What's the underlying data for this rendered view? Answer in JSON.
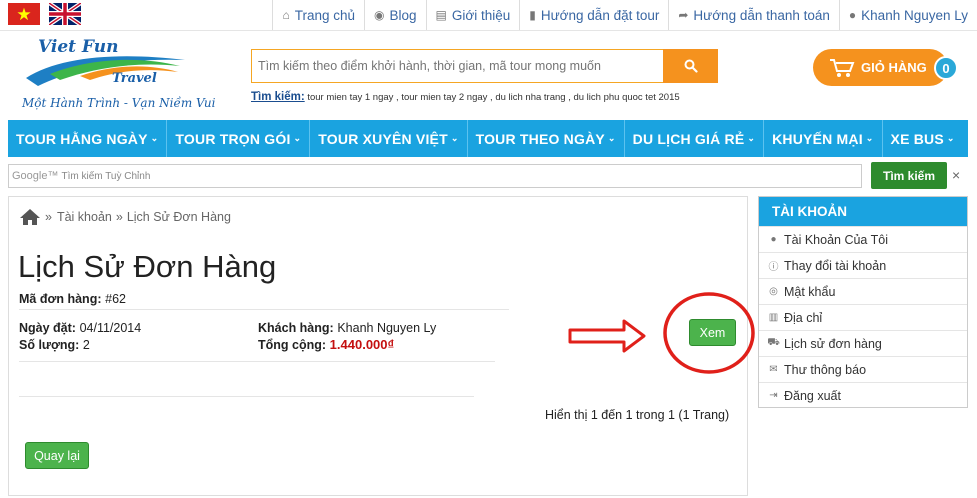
{
  "toplinks": [
    {
      "icon": "home-icon",
      "glyph": "⌂",
      "label": "Trang chủ"
    },
    {
      "icon": "globe-icon",
      "glyph": "◉",
      "label": "Blog"
    },
    {
      "icon": "list-icon",
      "glyph": "▤",
      "label": "Giới thiệu"
    },
    {
      "icon": "bookmark-icon",
      "glyph": "▮",
      "label": "Hướng dẫn đặt tour"
    },
    {
      "icon": "share-icon",
      "glyph": "➦",
      "label": "Hướng dẫn thanh toán"
    },
    {
      "icon": "user-icon",
      "glyph": "●",
      "label": "Khanh Nguyen Ly"
    }
  ],
  "logo": {
    "line1": "Viet Fun",
    "line2": "Travel",
    "slogan": "Một Hành Trình - Vạn Niềm Vui"
  },
  "search": {
    "placeholder": "Tìm kiếm theo điểm khởi hành, thời gian, mã tour mong muốn"
  },
  "hot": {
    "label": "Tìm kiếm:",
    "terms": " tour mien tay 1 ngay , tour mien tay 2 ngay , du lich nha trang , du lich phu quoc tet 2015"
  },
  "cart": {
    "label": "GIỎ HÀNG",
    "count": "0"
  },
  "nav": [
    "TOUR HẰNG NGÀY",
    "TOUR TRỌN GÓI",
    "TOUR XUYÊN VIỆT",
    "TOUR THEO NGÀY",
    "DU LỊCH GIÁ RẺ",
    "KHUYẾN MẠI",
    "XE BUS"
  ],
  "custom_search": {
    "brand": "Google™",
    "placeholder": "Tìm kiếm Tuỳ Chỉnh",
    "button": "Tìm kiếm",
    "close": "×"
  },
  "breadcrumb": {
    "sep1": "»",
    "item1": "Tài khoản",
    "sep2": "»",
    "item2": "Lịch Sử Đơn Hàng"
  },
  "page_title": "Lịch Sử Đơn Hàng",
  "order": {
    "id_label": "Mã đơn hàng:",
    "id_value": "#62",
    "date_label": "Ngày đặt:",
    "date_value": "04/11/2014",
    "qty_label": "Số lượng:",
    "qty_value": "2",
    "customer_label": "Khách hàng:",
    "customer_value": "Khanh Nguyen Ly",
    "total_label": "Tổng cộng:",
    "total_value": "1.440.000₫",
    "view_button": "Xem"
  },
  "pagination": "Hiển thị 1 đến 1 trong 1 (1 Trang)",
  "back_button": "Quay lại",
  "sidebar": {
    "title": "TÀI KHOẢN",
    "items": [
      {
        "icon": "user-icon",
        "glyph": "●",
        "label": "Tài Khoản Của Tôi"
      },
      {
        "icon": "info-icon",
        "glyph": "ⓘ",
        "label": "Thay đổi tài khoản"
      },
      {
        "icon": "eye-slash-icon",
        "glyph": "◎",
        "label": "Mật khẩu"
      },
      {
        "icon": "book-icon",
        "glyph": "▥",
        "label": "Địa chỉ"
      },
      {
        "icon": "cart-icon",
        "glyph": "⛟",
        "label": "Lịch sử đơn hàng"
      },
      {
        "icon": "envelope-icon",
        "glyph": "✉",
        "label": "Thư thông báo"
      },
      {
        "icon": "sign-out-icon",
        "glyph": "⇥",
        "label": "Đăng xuất"
      }
    ]
  },
  "colors": {
    "accent": "#1aa3e0",
    "orange": "#f5921e",
    "green": "#4cb34c",
    "price": "#c41010",
    "annotation": "#e0201a"
  }
}
